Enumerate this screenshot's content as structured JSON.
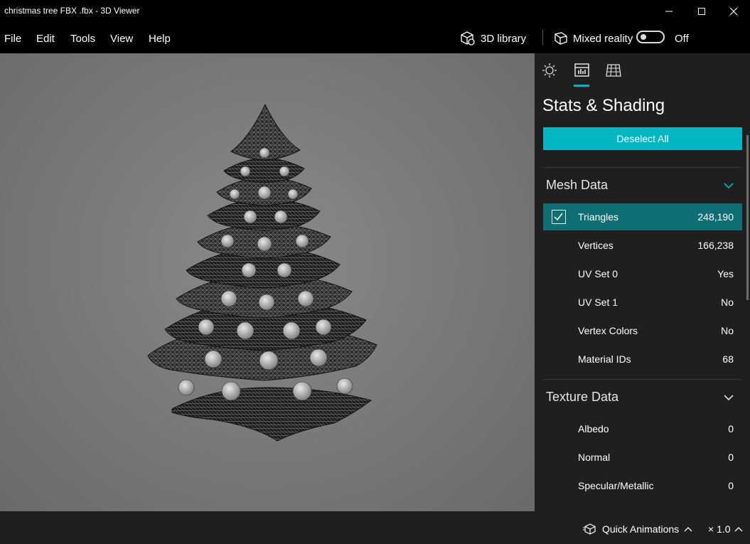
{
  "window": {
    "title": "christmas tree FBX .fbx - 3D Viewer"
  },
  "menu": {
    "items": [
      "File",
      "Edit",
      "Tools",
      "View",
      "Help"
    ],
    "library_label": "3D library",
    "mixed_reality_label": "Mixed reality",
    "toggle_state": "Off"
  },
  "panel": {
    "tabs": [
      "lighting-icon",
      "stats-icon",
      "grid-icon"
    ],
    "active_tab": 1,
    "title": "Stats & Shading",
    "deselect_label": "Deselect All",
    "mesh": {
      "header": "Mesh Data",
      "rows": [
        {
          "label": "Triangles",
          "value": "248,190",
          "checked": true
        },
        {
          "label": "Vertices",
          "value": "166,238"
        },
        {
          "label": "UV Set 0",
          "value": "Yes"
        },
        {
          "label": "UV Set 1",
          "value": "No"
        },
        {
          "label": "Vertex Colors",
          "value": "No"
        },
        {
          "label": "Material IDs",
          "value": "68"
        }
      ]
    },
    "texture": {
      "header": "Texture Data",
      "rows": [
        {
          "label": "Albedo",
          "value": "0"
        },
        {
          "label": "Normal",
          "value": "0"
        },
        {
          "label": "Specular/Metallic",
          "value": "0"
        }
      ]
    }
  },
  "status": {
    "animations_label": "Quick Animations",
    "speed_label": "× 1.0"
  },
  "colors": {
    "accent": "#00b7c3",
    "selected_row": "#0f6e75",
    "panel_bg": "#1f1f1f"
  }
}
